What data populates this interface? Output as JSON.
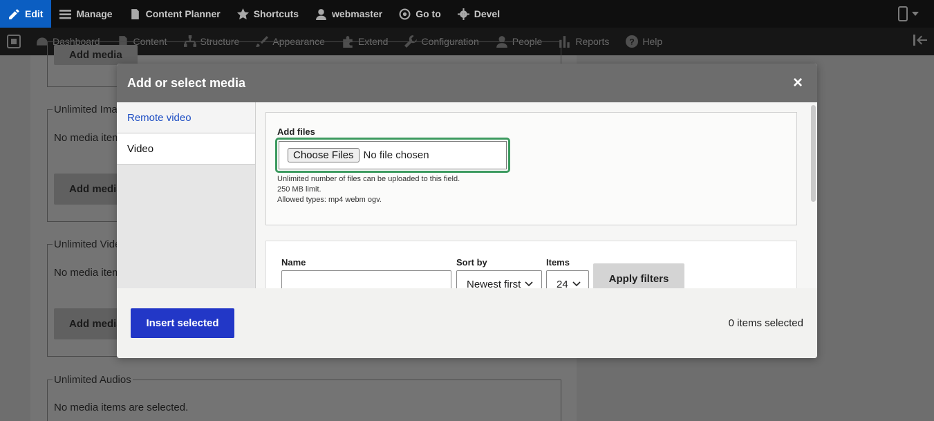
{
  "toolbar_primary": {
    "edit": "Edit",
    "manage": "Manage",
    "content_planner": "Content Planner",
    "shortcuts": "Shortcuts",
    "user": "webmaster",
    "goto": "Go to",
    "devel": "Devel"
  },
  "toolbar_secondary": {
    "dashboard": "Dashboard",
    "content": "Content",
    "structure": "Structure",
    "appearance": "Appearance",
    "extend": "Extend",
    "configuration": "Configuration",
    "people": "People",
    "reports": "Reports",
    "help": "Help"
  },
  "background": {
    "add_media_top": "Add media",
    "fieldset_images": "Unlimited Ima",
    "no_items_1": "No media item",
    "add_media_1": "Add media",
    "fieldset_videos": "Unlimited Vide",
    "no_items_2": "No media item",
    "add_media_2": "Add media",
    "fieldset_audios": "Unlimited Audios",
    "no_items_3": "No media items are selected."
  },
  "modal": {
    "title": "Add or select media",
    "close": "×",
    "tabs": [
      {
        "label": "Remote video"
      },
      {
        "label": "Video"
      }
    ],
    "upload": {
      "label": "Add files",
      "choose_button": "Choose Files",
      "no_file": "No file chosen",
      "help": [
        "Unlimited number of files can be uploaded to this field.",
        "250 MB limit.",
        "Allowed types: mp4 webm ogv."
      ]
    },
    "filters": {
      "name_label": "Name",
      "name_value": "",
      "sort_label": "Sort by",
      "sort_value": "Newest first",
      "items_label": "Items",
      "items_value": "24",
      "apply": "Apply filters"
    },
    "footer": {
      "insert": "Insert selected",
      "count": "0 items selected"
    }
  },
  "colors": {
    "accent": "#2237c7",
    "focus_ring": "#3c9a5f",
    "link": "#1f4fc4"
  }
}
